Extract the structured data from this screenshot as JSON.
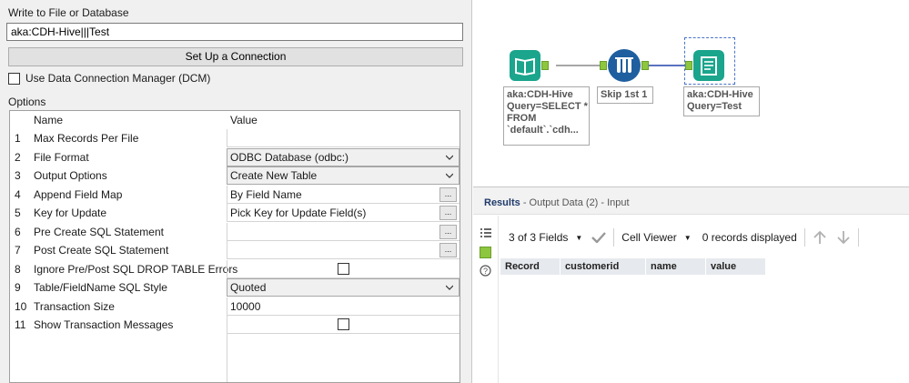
{
  "config": {
    "write_label": "Write to File or Database",
    "destination_value": "aka:CDH-Hive|||Test",
    "setup_button": "Set Up a Connection",
    "dcm_label": "Use Data Connection Manager (DCM)",
    "dcm_checked": false,
    "options_label": "Options",
    "table": {
      "col_name": "Name",
      "col_value": "Value",
      "rows": [
        {
          "num": "1",
          "name": "Max Records Per File",
          "value": "",
          "kind": "text"
        },
        {
          "num": "2",
          "name": "File Format",
          "value": "ODBC Database (odbc:)",
          "kind": "combo"
        },
        {
          "num": "3",
          "name": "Output Options",
          "value": "Create New Table",
          "kind": "combo"
        },
        {
          "num": "4",
          "name": "Append Field Map",
          "value": "By Field Name",
          "kind": "ellipsis"
        },
        {
          "num": "5",
          "name": "Key for Update",
          "value": "Pick Key for Update Field(s)",
          "kind": "ellipsis"
        },
        {
          "num": "6",
          "name": "Pre Create SQL Statement",
          "value": "",
          "kind": "ellipsis"
        },
        {
          "num": "7",
          "name": "Post Create SQL Statement",
          "value": "",
          "kind": "ellipsis"
        },
        {
          "num": "8",
          "name": "Ignore Pre/Post SQL DROP TABLE Errors",
          "value": "",
          "kind": "checkbox"
        },
        {
          "num": "9",
          "name": "Table/FieldName SQL Style",
          "value": "Quoted",
          "kind": "combo"
        },
        {
          "num": "10",
          "name": "Transaction Size",
          "value": "10000",
          "kind": "text"
        },
        {
          "num": "11",
          "name": "Show Transaction Messages",
          "value": "",
          "kind": "checkbox"
        }
      ]
    }
  },
  "canvas": {
    "tools": [
      {
        "id": "input",
        "label": "aka:CDH-Hive\nQuery=SELECT *\nFROM\n`default`.`cdh...",
        "color": "#1aa58c",
        "icon": "book-icon"
      },
      {
        "id": "sample",
        "label": "Skip 1st 1",
        "color": "#1f5fa0",
        "icon": "test-tubes-icon"
      },
      {
        "id": "output",
        "label": "aka:CDH-Hive\nQuery=Test",
        "color": "#1aa58c",
        "icon": "notepad-icon"
      }
    ]
  },
  "results": {
    "title": "Results",
    "subtitle": "- Output Data (2) - Input",
    "fields_label": "3 of 3 Fields",
    "cell_viewer_label": "Cell Viewer",
    "records_label": "0 records displayed",
    "columns": [
      "Record",
      "customerid",
      "name",
      "value"
    ]
  },
  "colors": {
    "accent": "#1f3a6b",
    "tool_green": "#1aa58c",
    "tool_blue": "#1f5fa0",
    "anchor_green": "#8dc63f"
  }
}
